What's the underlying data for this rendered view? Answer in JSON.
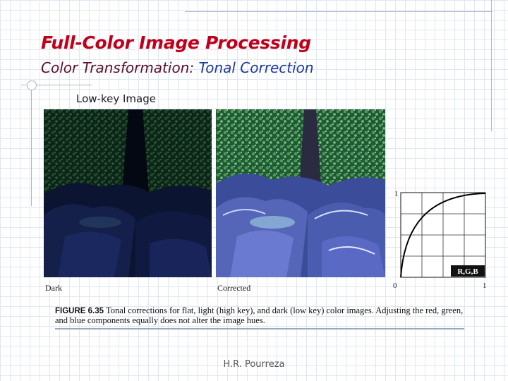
{
  "slide": {
    "title": "Full-Color Image Processing",
    "subtitle_part1": "Color Transformation:",
    "subtitle_part2": "Tonal Correction",
    "caption_top": "Low-key Image",
    "label_left": "Dark",
    "label_right": "Corrected",
    "figure_number": "FIGURE 6.35",
    "figure_caption": "Tonal corrections for flat, light (high key), and dark (low key) color images. Adjusting the red, green, and blue components equally does not alter the image hues.",
    "footer": "H.R. Pourreza"
  },
  "curve": {
    "y_tick_top": "1",
    "x_tick_left": "0",
    "x_tick_right": "1",
    "channel_label": "R,G,B"
  },
  "colors": {
    "title": "#c0001a",
    "subtitle_part1": "#5a0f2e",
    "subtitle_part2": "#1f3a9b"
  }
}
